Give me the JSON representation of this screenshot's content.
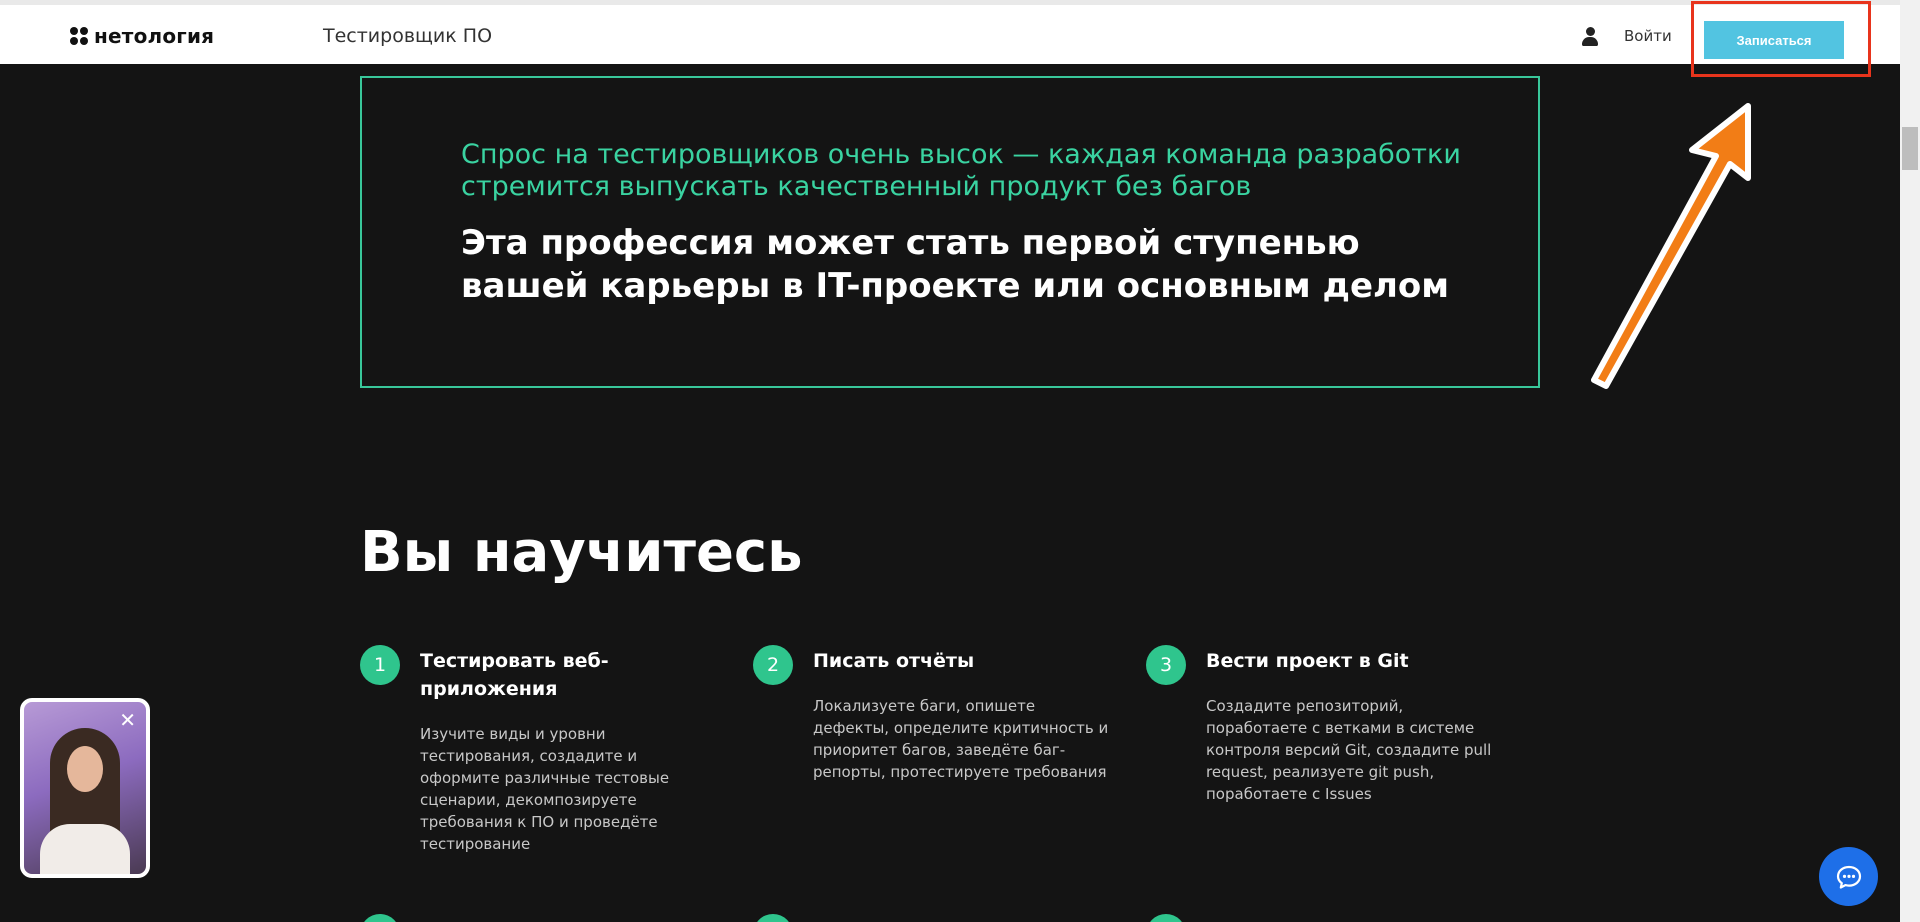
{
  "header": {
    "logo_text": "нетология",
    "course_title": "Тестировщик ПО",
    "login_label": "Войти",
    "signup_label": "Записаться"
  },
  "quote": {
    "green_text": "Спрос на тестировщиков очень высок — каждая команда разработки стремится выпускать качественный продукт без багов",
    "white_text": "Эта профессия может стать первой ступенью вашей карьеры в IT-проекте или основным делом"
  },
  "learn": {
    "title": "Вы научитесь",
    "items": [
      {
        "number": "1",
        "title": "Тестировать веб-приложения",
        "description": "Изучите виды и уровни тестирования, создадите и оформите различные тестовые сценарии, декомпозируете требования к ПО и проведёте тестирование"
      },
      {
        "number": "2",
        "title": "Писать отчёты",
        "description": "Локализуете баги, опишете дефекты, определите критичность и приоритет багов, заведёте баг-репорты, протестируете требования"
      },
      {
        "number": "3",
        "title": "Вести проект в Git",
        "description": "Создадите репозиторий, поработаете с ветками в системе контроля версий Git, создадите pull request, реализуете git push, поработаете с Issues"
      }
    ]
  },
  "colors": {
    "accent_green": "#3ad3a1",
    "signup_button": "#52c4e1",
    "highlight_box": "#e8341c",
    "annotation_arrow": "#f27d16",
    "chat_button": "#1e6fe8"
  },
  "icons": {
    "user": "user-icon",
    "close": "close-icon",
    "chat": "chat-icon"
  }
}
